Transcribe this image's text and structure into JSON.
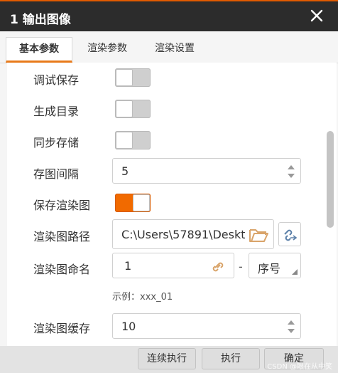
{
  "dialog": {
    "title": "1 输出图像",
    "close_icon": "close-icon"
  },
  "tabs": [
    {
      "label": "基本参数",
      "active": true
    },
    {
      "label": "渲染参数",
      "active": false
    },
    {
      "label": "渲染设置",
      "active": false
    }
  ],
  "form": {
    "debug_save": {
      "label": "调试保存",
      "on": false
    },
    "generate_dir": {
      "label": "生成目录",
      "on": false
    },
    "sync_storage": {
      "label": "同步存储",
      "on": false
    },
    "save_interval": {
      "label": "存图间隔",
      "value": "5"
    },
    "save_render": {
      "label": "保存渲染图",
      "on": true
    },
    "render_path": {
      "label": "渲染图路径",
      "value": "C:\\Users\\57891\\Deskt",
      "browse_icon": "folder-open-icon",
      "link_icon": "link-switch-icon"
    },
    "render_name": {
      "label": "渲染图命名",
      "value": "1",
      "link_icon": "link-icon",
      "separator": "-",
      "suffix_option": "序号"
    },
    "example": "示例：xxx_01",
    "render_cache": {
      "label": "渲染图缓存",
      "value": "10"
    }
  },
  "footer": {
    "continuous_run": "连续执行",
    "run": "执行",
    "confirm": "确定",
    "watermark": "CSDN @眼在从中笑"
  },
  "colors": {
    "accent": "#f16a00",
    "titlebar": "#2c2c2c"
  }
}
